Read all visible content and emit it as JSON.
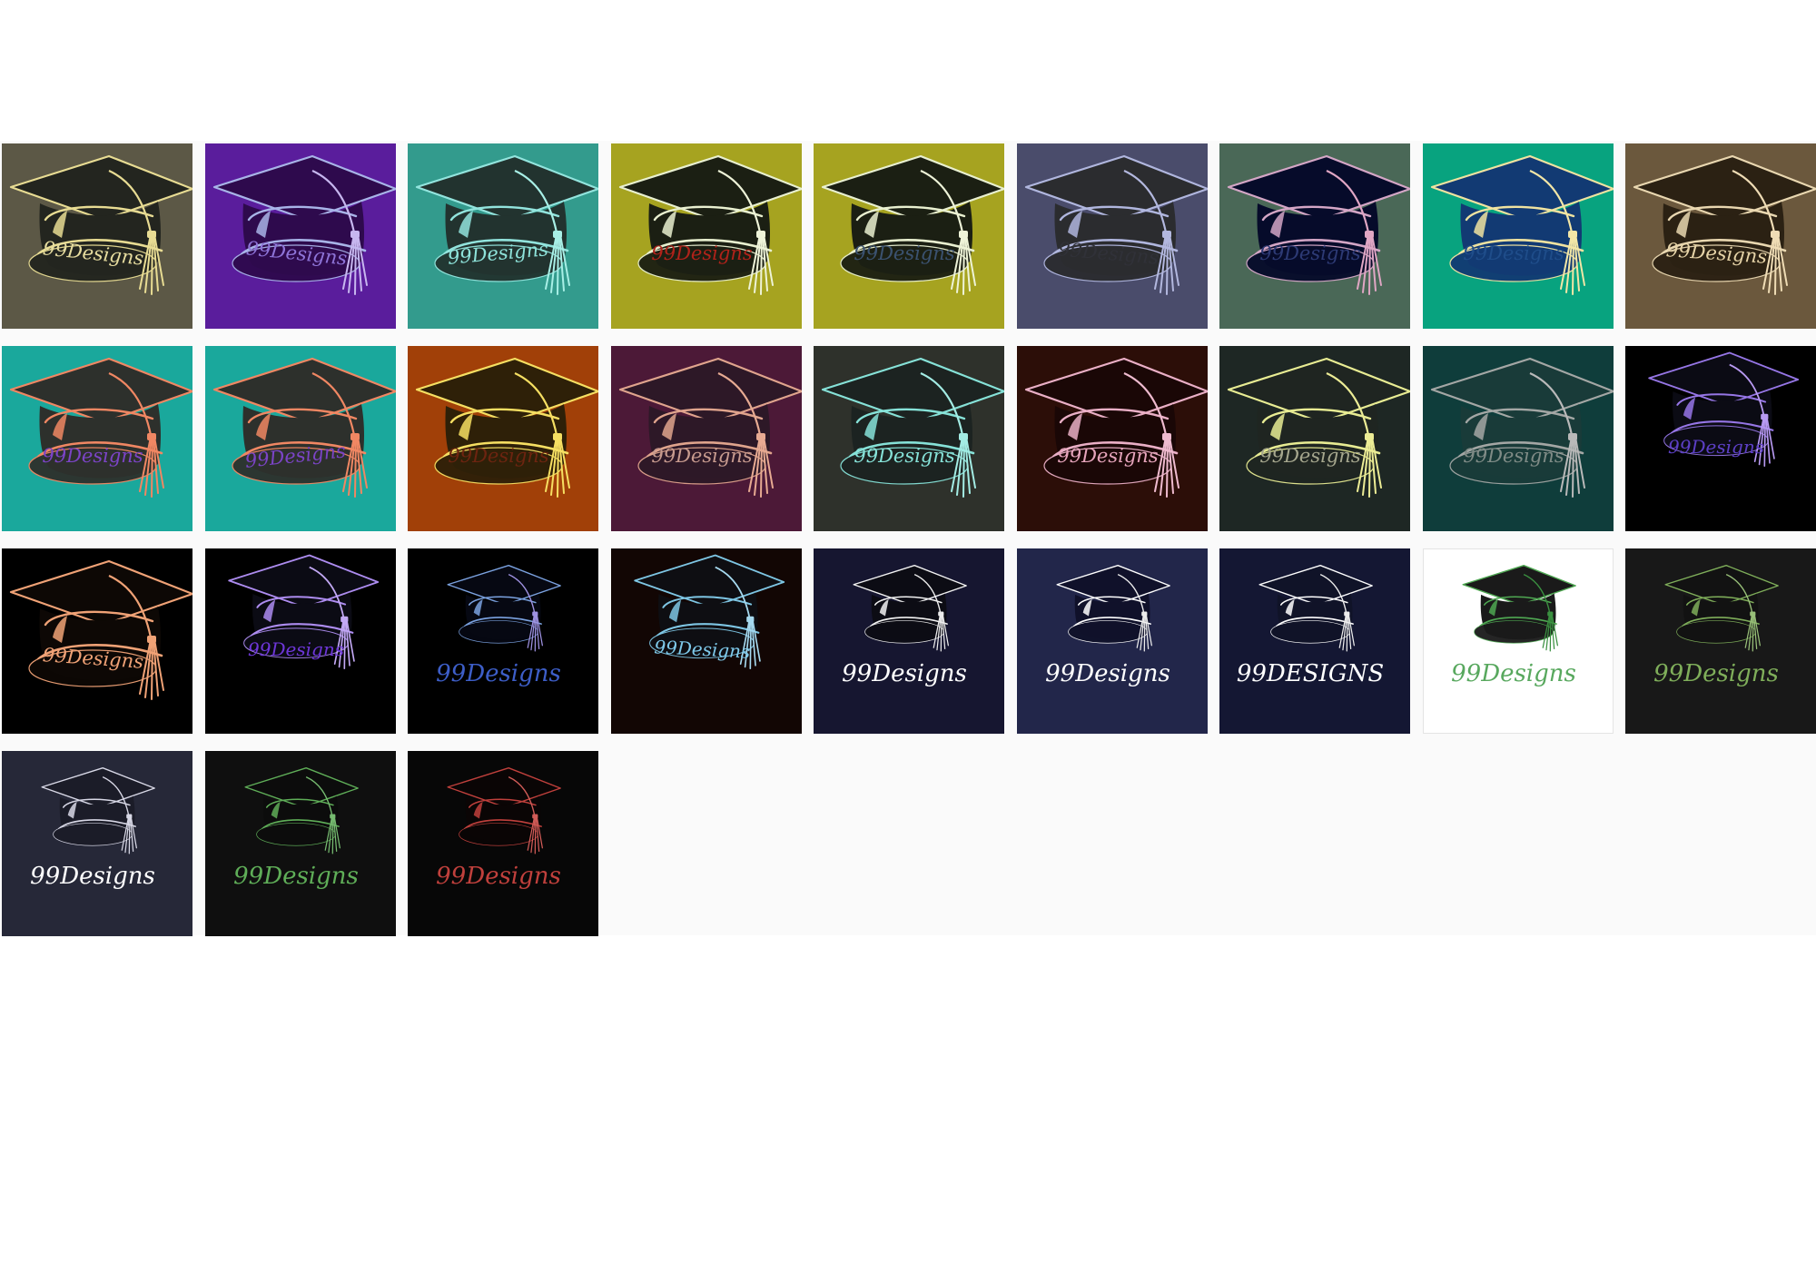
{
  "gallery": {
    "tiles": [
      {
        "text": "99Designs",
        "bg": "#5c5846",
        "hat": "#23251f",
        "line": "#e8dc93",
        "textColor": "#e6dc9f",
        "tassel": "#e8dc93",
        "style": "large",
        "textRot": 6
      },
      {
        "text": "99Designs",
        "bg": "#5a1d9c",
        "hat": "#2e0a4d",
        "line": "#a8b4e8",
        "textColor": "#8e74d8",
        "tassel": "#c7b7ef",
        "style": "large",
        "textRot": 6
      },
      {
        "text": "99Designs",
        "bg": "#339b8d",
        "hat": "#22332f",
        "line": "#92e4dd",
        "textColor": "#8ee3da",
        "tassel": "#a8efe6",
        "style": "large",
        "textRot": -5
      },
      {
        "text": "99Designs",
        "bg": "#a6a320",
        "hat": "#1b1f13",
        "line": "#e9f0d0",
        "textColor": "#b0221a",
        "tassel": "#eef3d8",
        "style": "large",
        "textRot": 0
      },
      {
        "text": "99Designs",
        "bg": "#a6a320",
        "hat": "#1b1f13",
        "line": "#e9f0d0",
        "textColor": "#3b5270",
        "tassel": "#eef3d8",
        "style": "large",
        "textRot": 0
      },
      {
        "text": "99Designs",
        "bg": "#4a4c6b",
        "hat": "#2b2c2f",
        "line": "#b0b6de",
        "textColor": "#303138",
        "tassel": "#b3b8df",
        "style": "large",
        "textRot": 5
      },
      {
        "text": "99Designs",
        "bg": "#4a6857",
        "hat": "#060b2a",
        "line": "#d4a6c6",
        "textColor": "#2d3a75",
        "tassel": "#e0a6c4",
        "style": "large",
        "textRot": 0
      },
      {
        "text": "99Designs",
        "bg": "#08a37f",
        "hat": "#123a73",
        "line": "#f0e3a0",
        "textColor": "#1f4d8a",
        "tassel": "#f3e6a6",
        "style": "large",
        "textRot": 0
      },
      {
        "text": "99Designs",
        "bg": "#6b583d",
        "hat": "#2b2113",
        "line": "#e9d7b0",
        "textColor": "#e6d3a7",
        "tassel": "#efdcb5",
        "style": "large",
        "textRot": 4
      },
      {
        "text": "99Designs",
        "bg": "#1aa89c",
        "hat": "#2d302c",
        "line": "#f08763",
        "textColor": "#7b44c6",
        "tassel": "#f08763",
        "style": "large",
        "textRot": 0
      },
      {
        "text": "99Designs",
        "bg": "#1aa89c",
        "hat": "#2d302c",
        "line": "#f08763",
        "textColor": "#7b44c6",
        "tassel": "#f08763",
        "style": "large",
        "textRot": -6
      },
      {
        "text": "99Designs",
        "bg": "#a14008",
        "hat": "#2e2008",
        "line": "#f6df62",
        "textColor": "#6d2410",
        "tassel": "#f6df62",
        "style": "large",
        "textRot": 0
      },
      {
        "text": "99Designs",
        "bg": "#4c1937",
        "hat": "#2d1827",
        "line": "#e0a48d",
        "textColor": "#c79a8e",
        "tassel": "#e7aa92",
        "style": "large",
        "textRot": 0
      },
      {
        "text": "99Designs",
        "bg": "#2e312b",
        "hat": "#1c2321",
        "line": "#86e2d8",
        "textColor": "#86e2d8",
        "tassel": "#a3ece4",
        "style": "large",
        "textRot": 0
      },
      {
        "text": "99Designs",
        "bg": "#2c0e08",
        "hat": "#1a0706",
        "line": "#eaafc6",
        "textColor": "#e6a4bb",
        "tassel": "#efbbcf",
        "style": "large",
        "textRot": 0
      },
      {
        "text": "99Designs",
        "bg": "#1e2724",
        "hat": "#1f2521",
        "line": "#e8ec93",
        "textColor": "#a5a68d",
        "tassel": "#ecec95",
        "style": "large",
        "textRot": 0
      },
      {
        "text": "99Designs",
        "bg": "#0f3d3b",
        "hat": "#193b39",
        "line": "#a4a7a5",
        "textColor": "#7f8b86",
        "tassel": "#b9b9b9",
        "style": "large",
        "textRot": 0
      },
      {
        "text": "99Designs",
        "bg": "#000000",
        "hat": "#0b0b14",
        "line": "#9676e6",
        "textColor": "#5c3fc6",
        "tassel": "#b89af2",
        "style": "medium",
        "textRot": 0
      },
      {
        "text": "99Designs",
        "bg": "#000000",
        "hat": "#0d0805",
        "line": "#f0a276",
        "textColor": "#f0a276",
        "tassel": "#f0a276",
        "style": "large",
        "textRot": 4
      },
      {
        "text": "99Designs",
        "bg": "#000000",
        "hat": "#0b0b14",
        "line": "#ad8cf0",
        "textColor": "#6d36d8",
        "tassel": "#c3a9f5",
        "style": "medium",
        "textRot": 0
      },
      {
        "text": "99Designs",
        "bg": "#000000",
        "hat": "#060812",
        "line": "#7ba2e0",
        "textColor": "#3d5ec8",
        "tassel": "#9f92e2",
        "style": "small",
        "textRot": 0
      },
      {
        "text": "99Designs",
        "bg": "#120604",
        "hat": "#0e0e12",
        "line": "#7ec6e4",
        "textColor": "#7ec9ea",
        "tassel": "#a6d9ef",
        "style": "medium",
        "textRot": 3
      },
      {
        "text": "99Designs",
        "bg": "#161630",
        "hat": "#0c0c14",
        "line": "#f2f2f2",
        "textColor": "#ffffff",
        "tassel": "#ececec",
        "style": "small",
        "textRot": 0
      },
      {
        "text": "99Designs",
        "bg": "#22264a",
        "hat": "#10112a",
        "line": "#ffffff",
        "textColor": "#ffffff",
        "tassel": "#ececec",
        "style": "small",
        "textRot": 0
      },
      {
        "text": "99DESIGNS",
        "bg": "#141733",
        "hat": "#101328",
        "line": "#ffffff",
        "textColor": "#ffffff",
        "tassel": "#ececec",
        "style": "small",
        "textRot": 0
      },
      {
        "text": "99Designs",
        "bg": "#ffffff",
        "hat": "#1a1a1a",
        "line": "#4fa852",
        "textColor": "#58a85e",
        "tassel": "#3a9040",
        "style": "small",
        "textRot": 0
      },
      {
        "text": "99Designs",
        "bg": "#181818",
        "hat": "#121212",
        "line": "#7fae5a",
        "textColor": "#7fae5a",
        "tassel": "#98bf78",
        "style": "small",
        "textRot": 0
      },
      {
        "text": "99Designs",
        "bg": "#262838",
        "hat": "#1b1c28",
        "line": "#d8d8e6",
        "textColor": "#ffffff",
        "tassel": "#d8d8e6",
        "style": "small",
        "textRot": 0
      },
      {
        "text": "99Designs",
        "bg": "#0f0f0f",
        "hat": "#0c0c0c",
        "line": "#5fae58",
        "textColor": "#5fae58",
        "tassel": "#76bb70",
        "style": "small",
        "textRot": 0
      },
      {
        "text": "99Designs",
        "bg": "#070707",
        "hat": "#0a0505",
        "line": "#c0403c",
        "textColor": "#c0403c",
        "tassel": "#d25c58",
        "style": "small",
        "textRot": 0
      }
    ]
  }
}
